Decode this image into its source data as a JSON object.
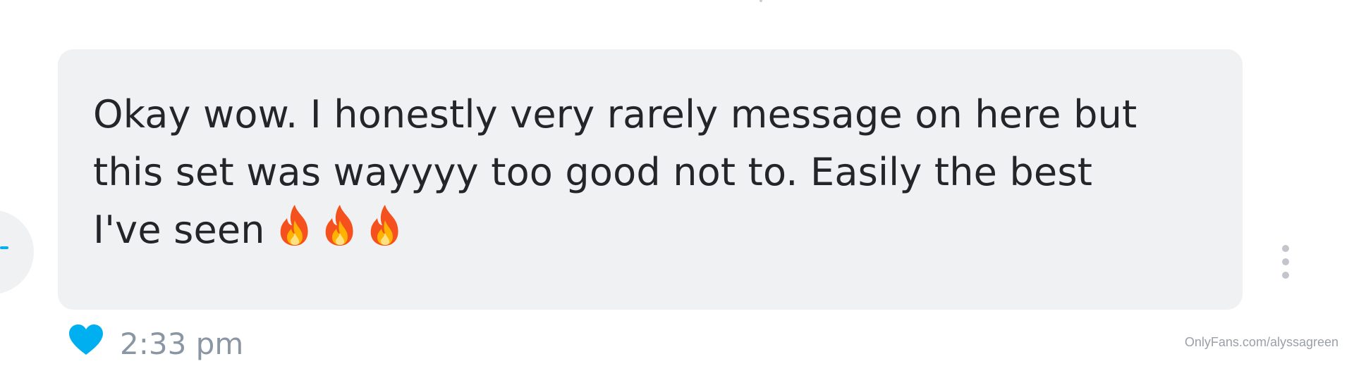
{
  "message": {
    "lines": [
      "Okay wow. I honestly very rarely message on here but",
      "this set was wayyyy too good not to. Easily the best",
      "I've seen"
    ],
    "emojis": [
      "fire-emoji",
      "fire-emoji",
      "fire-emoji"
    ],
    "bubble_color": "#f0f1f3",
    "text_color": "#242529"
  },
  "meta": {
    "time": "2:33 pm",
    "liked": true,
    "like_icon": "heart-icon",
    "like_color": "#00aff0",
    "more_icon": "more-vertical-icon"
  },
  "watermark": "OnlyFans.com/alyssagreen"
}
